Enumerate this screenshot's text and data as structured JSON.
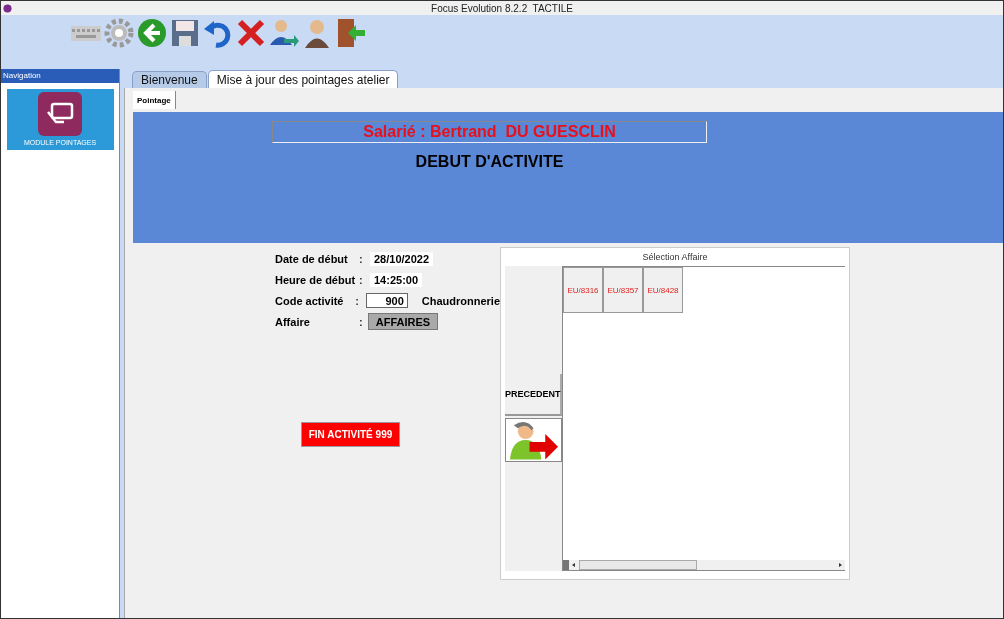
{
  "window": {
    "title": "Focus Evolution 8.2.2  TACTILE"
  },
  "navigation": {
    "title": "Navigation",
    "items": [
      {
        "label": "MODULE POINTAGES",
        "selected": true
      }
    ]
  },
  "tabs": [
    {
      "label": "Bienvenue",
      "selected": false
    },
    {
      "label": "Mise à jour des pointages atelier",
      "selected": true
    }
  ],
  "subtabs": [
    {
      "label": "Pointage",
      "selected": true
    }
  ],
  "header": {
    "employee": "Salarié : Bertrand  DU GUESCLIN",
    "heading": "DEBUT D'ACTIVITE"
  },
  "form": [
    {
      "label": "Date de début",
      "colon": ":",
      "kind": "value",
      "value": "28/10/2022"
    },
    {
      "label": "Heure de début",
      "colon": ":",
      "kind": "value",
      "value": "14:25:00"
    },
    {
      "label": "Code activité",
      "colon": ":",
      "kind": "input",
      "value": "900",
      "note": "Chaudronnerie"
    },
    {
      "label": "Affaire",
      "colon": ":",
      "kind": "button",
      "value": "AFFAIRES"
    }
  ],
  "end_button": "FIN ACTIVITÉ 999",
  "selection": {
    "title": "Sélection Affaire",
    "previous": "PRECEDENT",
    "items": [
      "EU/8316",
      "EU/8357",
      "EU/8428"
    ]
  }
}
